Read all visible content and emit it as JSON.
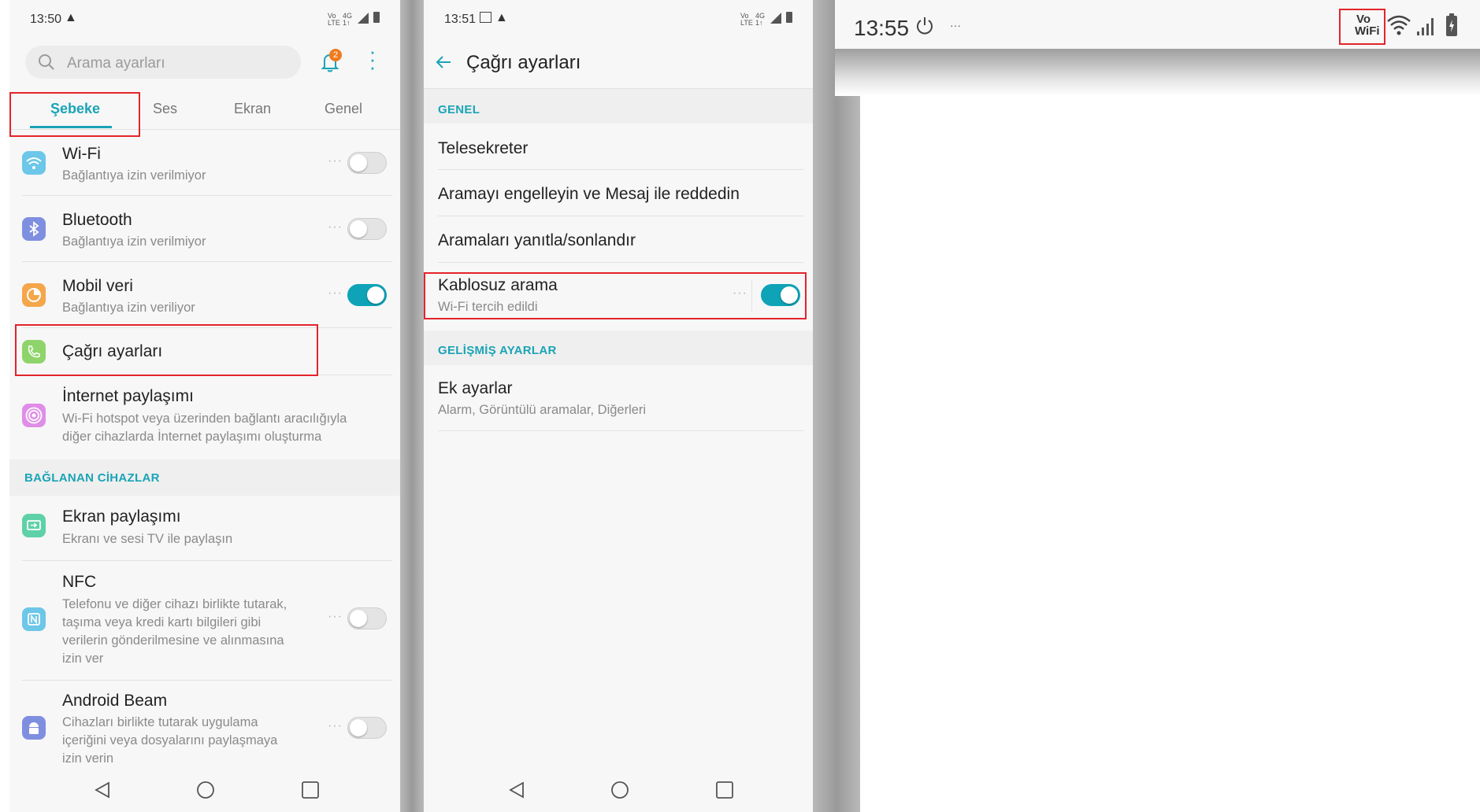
{
  "panel1": {
    "status": {
      "time": "13:50"
    },
    "search": {
      "placeholder": "Arama ayarları"
    },
    "notification_count": "2",
    "tabs": [
      "Şebeke",
      "Ses",
      "Ekran",
      "Genel"
    ],
    "items": [
      {
        "title": "Wi-Fi",
        "subtitle": "Bağlantıya izin verilmiyor"
      },
      {
        "title": "Bluetooth",
        "subtitle": "Bağlantıya izin verilmiyor"
      },
      {
        "title": "Mobil veri",
        "subtitle": "Bağlantıya izin veriliyor"
      },
      {
        "title": "Çağrı ayarları",
        "subtitle": ""
      },
      {
        "title": "İnternet paylaşımı",
        "subtitle_l1": "Wi-Fi hotspot veya üzerinden bağlantı aracılığıyla",
        "subtitle_l2": "diğer cihazlarda İnternet paylaşımı oluşturma"
      }
    ],
    "section_connected": "BAĞLANAN CİHAZLAR",
    "connected_items": [
      {
        "title": "Ekran paylaşımı",
        "subtitle": "Ekranı ve sesi TV ile paylaşın"
      },
      {
        "title": "NFC",
        "subtitle_l1": "Telefonu ve diğer cihazı birlikte tutarak,",
        "subtitle_l2": "taşıma veya kredi kartı bilgileri gibi",
        "subtitle_l3": "verilerin gönderilmesine ve alınmasına",
        "subtitle_l4": "izin ver"
      },
      {
        "title": "Android Beam",
        "subtitle_l1": "Cihazları birlikte tutarak uygulama",
        "subtitle_l2": "içeriğini veya dosyalarını paylaşmaya",
        "subtitle_l3": "izin verin"
      }
    ],
    "toggles": {
      "wifi": false,
      "bluetooth": false,
      "mobile_data": true,
      "nfc": false,
      "android_beam": false
    }
  },
  "panel2": {
    "status": {
      "time": "13:51"
    },
    "title": "Çağrı ayarları",
    "section_general": "GENEL",
    "items": [
      "Telesekreter",
      "Aramayı engelleyin ve Mesaj ile reddedin",
      "Aramaları yanıtla/sonlandır"
    ],
    "wireless": {
      "title": "Kablosuz arama",
      "subtitle": "Wi-Fi tercih edildi",
      "enabled": true
    },
    "section_advanced": "GELİŞMİŞ AYARLAR",
    "extra": {
      "title": "Ek ayarlar",
      "subtitle": "Alarm, Görüntülü aramalar, Diğerleri"
    }
  },
  "panel3": {
    "time": "13:55",
    "dots": "···",
    "vowifi": {
      "line1": "Vo",
      "line2": "WiFi"
    }
  },
  "colors": {
    "accent": "#1aa4b6",
    "highlight": "#e3242b",
    "notification": "#f07a1e"
  }
}
